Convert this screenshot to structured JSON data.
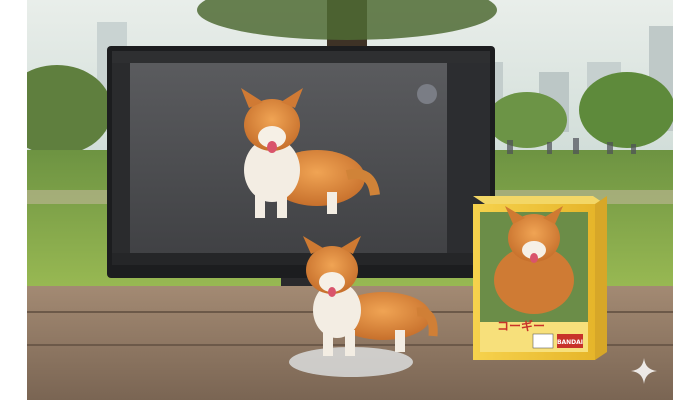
{
  "image": {
    "description_name": "corgi-figure-photo",
    "monitor_brand_mark": "",
    "box": {
      "top_kana_line": "",
      "main_title": "コーギー",
      "maker_logo": "BANDAI"
    }
  },
  "colors": {
    "sky": "#dde7e3",
    "grass": "#7fa84a",
    "table": "#8f7a66",
    "screen_bg": "#4e4f52",
    "corgi_orange": "#d9843a",
    "corgi_white": "#f5efe6",
    "box_yellow": "#f1c93a",
    "box_red": "#c8322a"
  }
}
